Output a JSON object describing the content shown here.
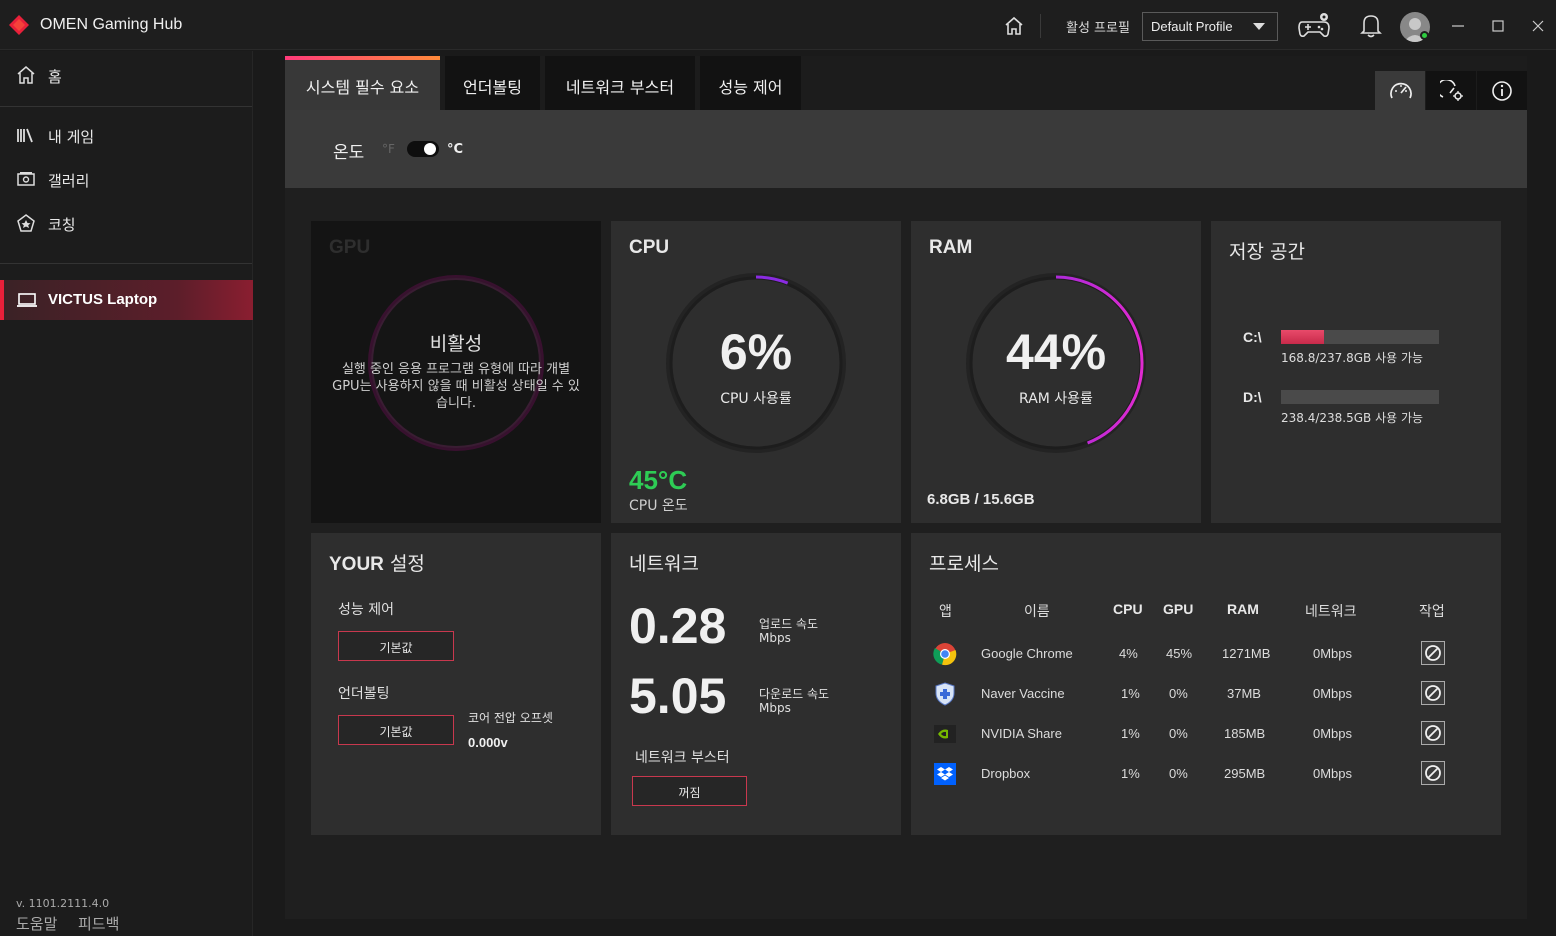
{
  "app": {
    "title": "OMEN Gaming Hub",
    "active_profile_label": "활성 프로필",
    "profile_value": "Default Profile"
  },
  "sidebar": {
    "items": [
      {
        "label": "홈",
        "icon": "home-icon"
      },
      {
        "label": "내 게임",
        "icon": "library-icon"
      },
      {
        "label": "갤러리",
        "icon": "gallery-icon"
      },
      {
        "label": "코칭",
        "icon": "coaching-icon"
      }
    ],
    "device": {
      "label": "VICTUS Laptop",
      "icon": "laptop-icon"
    },
    "version": "v. 1101.2111.4.0",
    "help": "도움말",
    "feedback": "피드백"
  },
  "tabs": [
    "시스템 필수 요소",
    "언더볼팅",
    "네트워크 부스터",
    "성능 제어"
  ],
  "temperature": {
    "label": "온도",
    "unit_f": "°F",
    "unit_c": "°C",
    "selected": "°C"
  },
  "gpu": {
    "title": "GPU",
    "status": "비활성",
    "description": "실행 중인 응용 프로그램 유형에 따라 개별 GPU는 사용하지 않을 때 비활성 상태일 수 있습니다."
  },
  "cpu": {
    "title": "CPU",
    "usage": "6%",
    "usage_fraction": 0.06,
    "usage_label": "CPU 사용률",
    "temp": "45°C",
    "temp_label": "CPU 온도"
  },
  "ram": {
    "title": "RAM",
    "usage": "44%",
    "usage_fraction": 0.44,
    "usage_label": "RAM 사용률",
    "total": "6.8GB / 15.6GB"
  },
  "storage": {
    "title": "저장 공간",
    "drives": [
      {
        "label": "C:\\",
        "info": "168.8/237.8GB 사용 가능",
        "used_fraction": 0.27
      },
      {
        "label": "D:\\",
        "info": "238.4/238.5GB 사용 가능",
        "used_fraction": 0.0
      }
    ]
  },
  "settings": {
    "title_prefix": "YOUR",
    "title_suffix": "설정",
    "performance_label": "성능 제어",
    "performance_value": "기본값",
    "undervolt_label": "언더볼팅",
    "undervolt_value": "기본값",
    "offset_label": "코어 전압 오프셋",
    "offset_value": "0.000v"
  },
  "network": {
    "title": "네트워크",
    "upload": "0.28",
    "upload_label": "업로드 속도",
    "download": "5.05",
    "download_label": "다운로드 속도",
    "unit": "Mbps",
    "booster_label": "네트워크 부스터",
    "booster_value": "꺼짐"
  },
  "processes": {
    "title": "프로세스",
    "headers": [
      "앱",
      "이름",
      "CPU",
      "GPU",
      "RAM",
      "네트워크",
      "작업"
    ],
    "rows": [
      {
        "icon": "chrome-icon",
        "name": "Google Chrome",
        "cpu": "4%",
        "gpu": "45%",
        "ram": "1271MB",
        "net": "0Mbps"
      },
      {
        "icon": "naver-vaccine-icon",
        "name": "Naver Vaccine",
        "cpu": "1%",
        "gpu": "0%",
        "ram": "37MB",
        "net": "0Mbps"
      },
      {
        "icon": "nvidia-icon",
        "name": "NVIDIA Share",
        "cpu": "1%",
        "gpu": "0%",
        "ram": "185MB",
        "net": "0Mbps"
      },
      {
        "icon": "dropbox-icon",
        "name": "Dropbox",
        "cpu": "1%",
        "gpu": "0%",
        "ram": "295MB",
        "net": "0Mbps"
      }
    ]
  },
  "colors": {
    "accent": "#e8203a",
    "gauge": "#a020e0",
    "temp_ok": "#2ecc55"
  }
}
